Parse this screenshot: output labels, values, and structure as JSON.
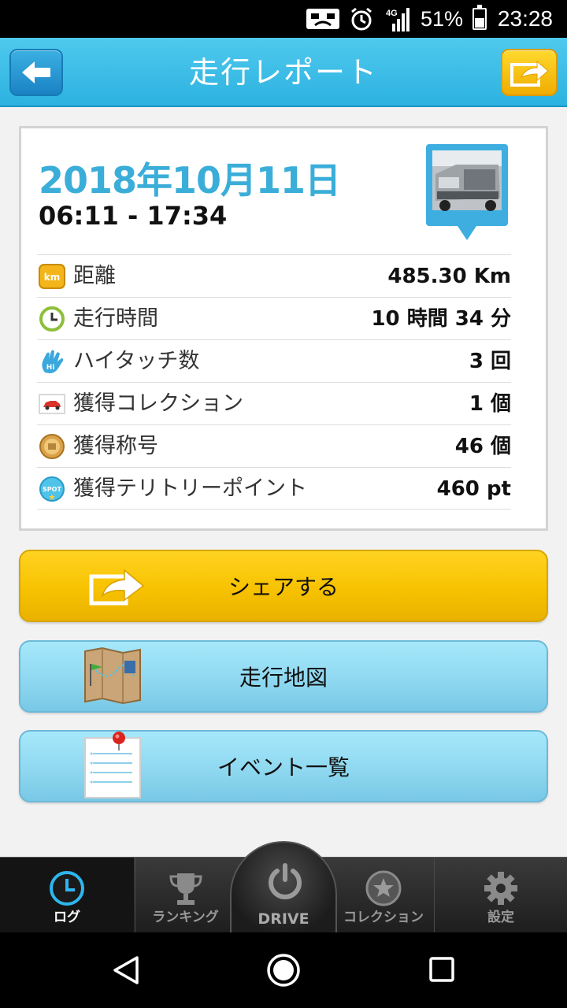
{
  "status_bar": {
    "network": "4G",
    "battery": "51%",
    "battery_level": 0.51,
    "time": "23:28",
    "icons": [
      "notification-icon",
      "alarm-icon",
      "signal-icon",
      "battery-icon"
    ]
  },
  "header": {
    "title": "走行レポート",
    "back_icon": "back-arrow-icon",
    "share_icon": "share-icon",
    "accent": "#2cb2e0"
  },
  "report": {
    "date": "2018年10月11日",
    "time_range": "06:11 - 17:34",
    "vehicle_icon": "car-photo-pin-icon",
    "date_color": "#3aaed8",
    "stats": [
      {
        "icon": "km-icon",
        "label": "距離",
        "value": "485.30 Km"
      },
      {
        "icon": "clock-icon",
        "label": "走行時間",
        "value": "10 時間 34 分"
      },
      {
        "icon": "high-five-icon",
        "label": "ハイタッチ数",
        "value": "3 回"
      },
      {
        "icon": "car-collection-icon",
        "label": "獲得コレクション",
        "value": "1 個"
      },
      {
        "icon": "medal-icon",
        "label": "獲得称号",
        "value": "46 個"
      },
      {
        "icon": "spot-icon",
        "label": "獲得テリトリーポイント",
        "value": "460 pt"
      }
    ]
  },
  "actions": {
    "share": {
      "label": "シェアする",
      "icon": "share-icon",
      "color": "#f7c200"
    },
    "map": {
      "label": "走行地図",
      "icon": "map-icon",
      "color": "#8fd8f0"
    },
    "events": {
      "label": "イベント一覧",
      "icon": "event-list-icon",
      "color": "#8fd8f0"
    }
  },
  "tabs": {
    "log": {
      "label": "ログ",
      "icon": "clock-icon",
      "active": true
    },
    "ranking": {
      "label": "ランキング",
      "icon": "trophy-icon"
    },
    "drive": {
      "label": "DRIVE",
      "icon": "power-icon"
    },
    "collection": {
      "label": "コレクション",
      "icon": "star-icon"
    },
    "settings": {
      "label": "設定",
      "icon": "gear-icon"
    }
  },
  "android_nav": {
    "back": "back-triangle-icon",
    "home": "home-circle-icon",
    "recent": "recent-apps-icon"
  }
}
